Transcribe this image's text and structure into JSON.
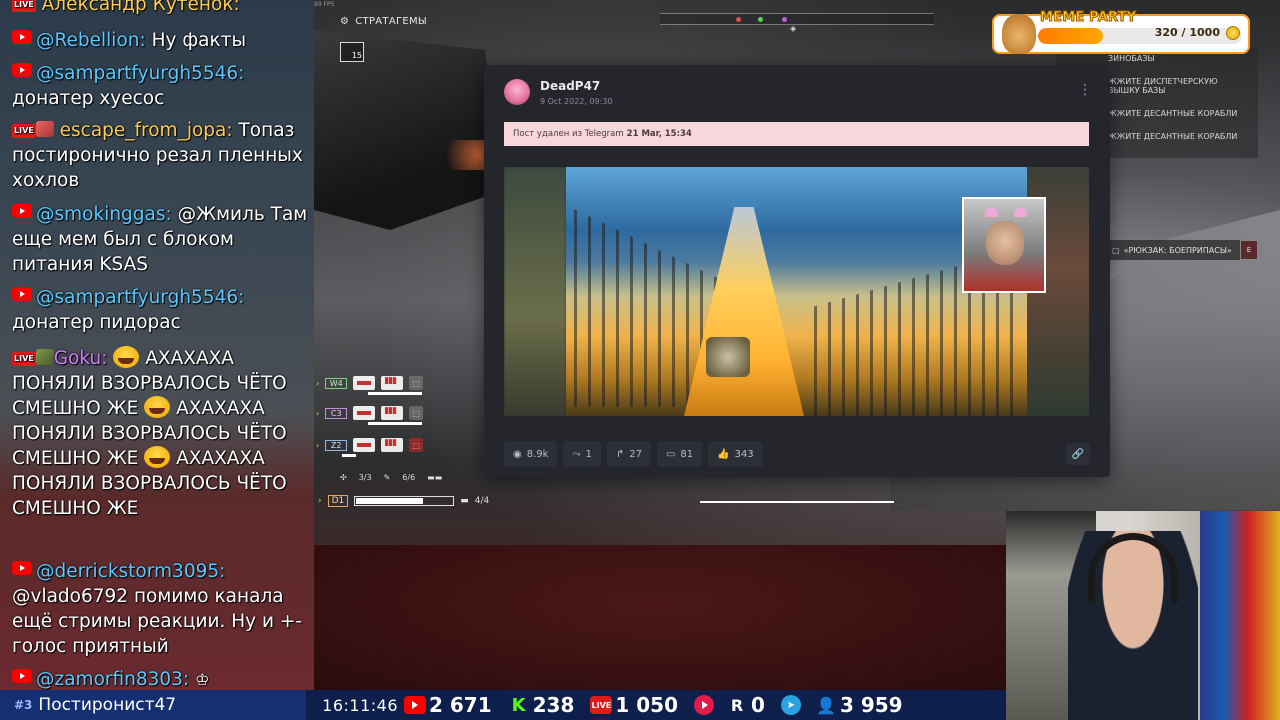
{
  "game": {
    "fps": "89 FPS",
    "stratagems_label": "СТРАТАГЕМЫ",
    "stratagem_count": "15",
    "objectives": [
      "ЗИНОБАЗЫ",
      "ЖЖИТЕ ДИСПЕТЧЕРСКУЮ ВЫШКУ БАЗЫ",
      "ЖЖИТЕ ДЕСАНТНЫЕ КОРАБЛИ",
      "ЖЖИТЕ ДЕСАНТНЫЕ КОРАБЛИ"
    ],
    "pickup_label": "«РЮКЗАК: БОЕПРИПАСЫ»",
    "weapons": [
      {
        "code": "W4"
      },
      {
        "code": "C3"
      },
      {
        "code": "Z2"
      }
    ],
    "ammo_grenades": "3/3",
    "ammo_stims": "6/6",
    "primary_code": "D1",
    "primary_mags": "4/4",
    "primary_fill": 0.7
  },
  "meme_party": {
    "title": "MEME PARTY",
    "current": 320,
    "goal": 1000,
    "score_label": "320 / 1000"
  },
  "post": {
    "author": "DeadP47",
    "date": "9 Oct 2022, 09:30",
    "deleted_prefix": "Пост удален из Telegram",
    "deleted_date": "21 Mar, 15:34",
    "stats": {
      "views": "8.9k",
      "shares": "1",
      "forwards": "27",
      "comments": "81",
      "likes": "343"
    }
  },
  "chat": {
    "messages": [
      {
        "author": "Александр Кутёнок:",
        "text": ""
      },
      {
        "author": "@Rebellion:",
        "text": "Ну факты"
      },
      {
        "author": "@sampartfyurgh5546:",
        "text": "донатер хуесос"
      },
      {
        "author": "escape_from_jopa:",
        "text": "Топаз постиронично резал пленных хохлов"
      },
      {
        "author": "@smokinggas:",
        "text": "@Жмиль Там еще мем был с блоком питания KSAS"
      },
      {
        "author": "@sampartfyurgh5546:",
        "text": "донатер пидорас"
      },
      {
        "author": "Goku:",
        "text_parts": [
          "АХАХАХА ПОНЯЛИ ВЗОРВАЛОСЬ ЧЁТО СМЕШНО ЖЕ",
          "АХАХАХА ПОНЯЛИ ВЗОРВАЛОСЬ ЧЁТО СМЕШНО ЖЕ",
          "АХАХАХА ПОНЯЛИ ВЗОРВАЛОСЬ ЧЁТО СМЕШНО ЖЕ"
        ]
      },
      {
        "author": "@derrickstorm3095:",
        "text": "@vlado6792 помимо канала ещё стримы реакции. Ну и +- голос приятный"
      },
      {
        "author": "@zamorfin8303:",
        "text": ""
      }
    ]
  },
  "bottom_bar": {
    "rank_num": "#3",
    "rank_name": "Постиронист47",
    "time": "16:11:46",
    "youtube": "2 671",
    "kick": "238",
    "vk": "1 050",
    "rutube": "0",
    "viewers": "3 959",
    "live_badge": "LIVE"
  },
  "colors": {
    "accent_blue": "#5bc8ff",
    "bar_bg": "#0d1f4a",
    "post_bg": "#24262b",
    "deleted_bg": "#f7d6dc"
  }
}
